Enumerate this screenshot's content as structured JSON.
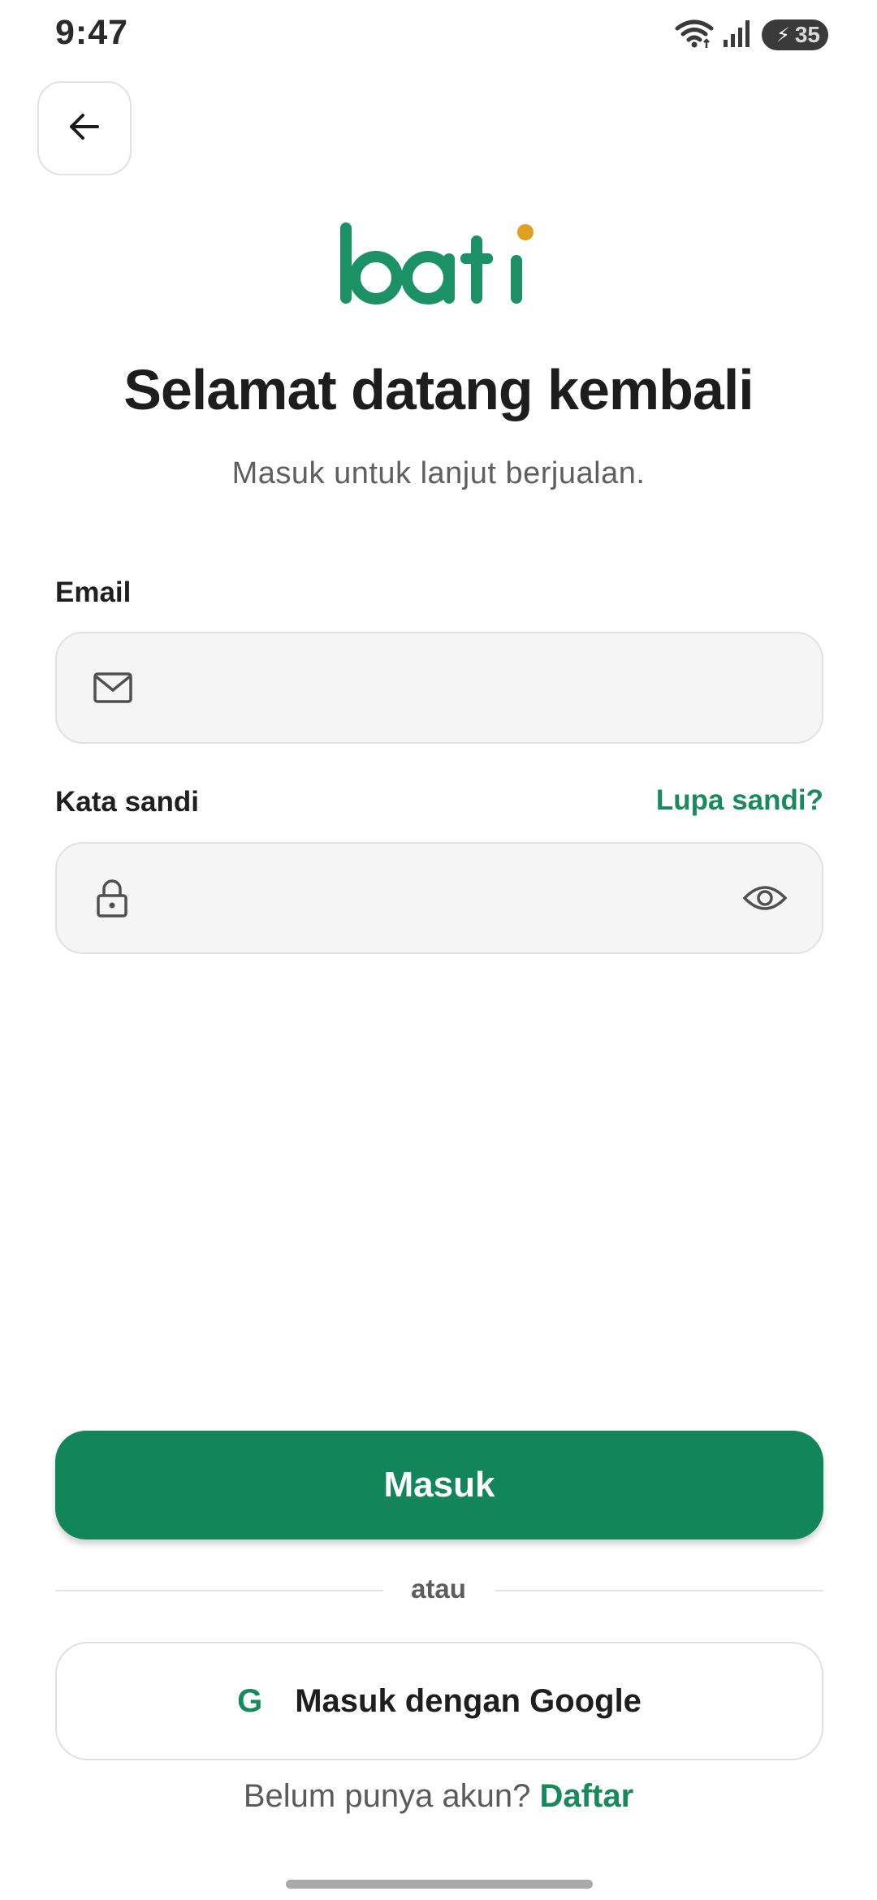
{
  "status_bar": {
    "time": "9:47",
    "battery": "35"
  },
  "brand": {
    "logo_text": "bati",
    "primary_color": "#12855a",
    "accent_dot_color": "#e0a020"
  },
  "header": {
    "title": "Selamat datang kembali",
    "subtitle": "Masuk untuk lanjut berjualan."
  },
  "form": {
    "email_label": "Email",
    "email_value": "",
    "password_label": "Kata sandi",
    "password_value": "",
    "forgot_link": "Lupa sandi?"
  },
  "actions": {
    "login_button": "Masuk",
    "divider_text": "atau",
    "google_button": "Masuk dengan Google",
    "google_icon_glyph": "G"
  },
  "footer": {
    "signup_prompt": "Belum punya akun?",
    "signup_link": "Daftar"
  },
  "icons": [
    "back-arrow-icon",
    "mail-icon",
    "lock-icon",
    "eye-icon",
    "wifi-icon",
    "signal-icon",
    "battery-icon"
  ]
}
